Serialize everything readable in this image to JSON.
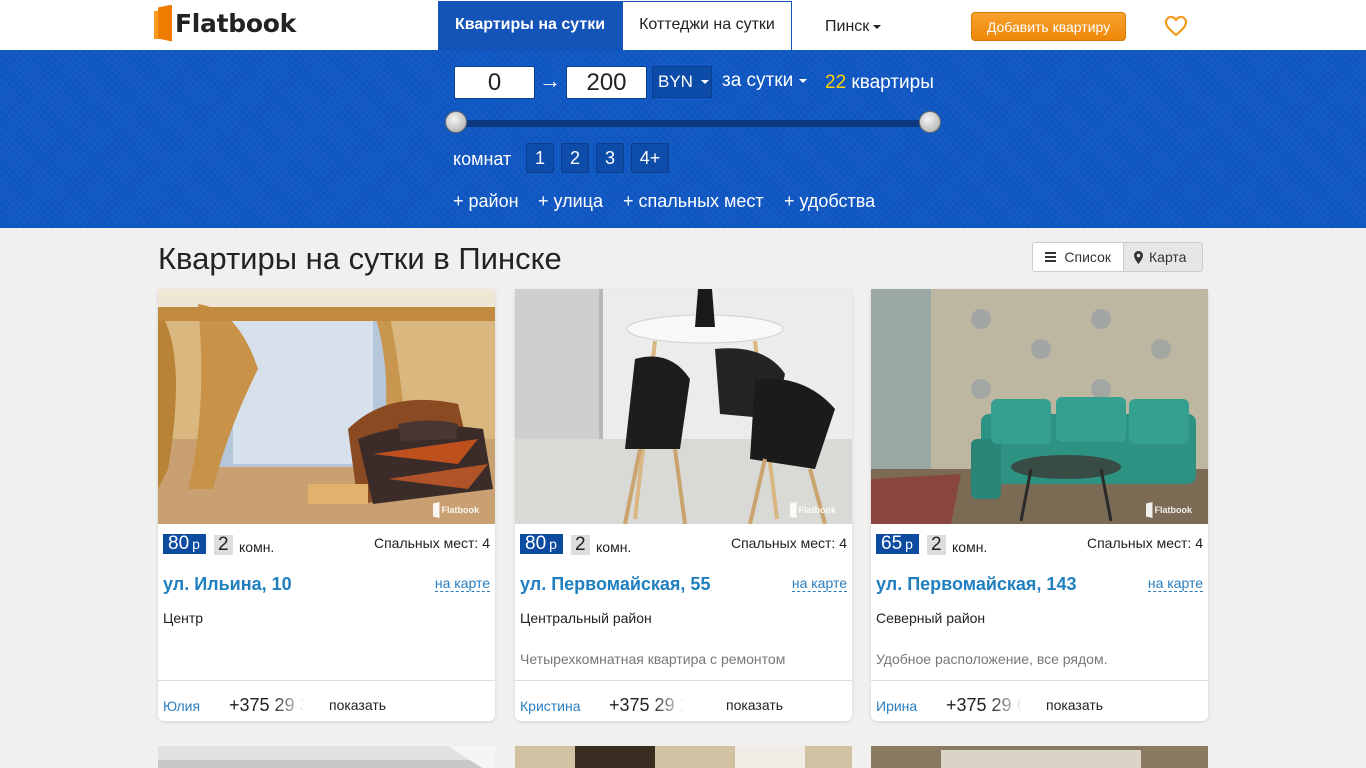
{
  "header": {
    "logo_text": "Flatbook",
    "tabs": [
      {
        "label": "Квартиры на сутки",
        "active": true
      },
      {
        "label": "Коттеджи на сутки",
        "active": false
      }
    ],
    "city": "Пинск",
    "add_button": "Добавить квартиру",
    "favorites_icon": "heart-icon"
  },
  "filter": {
    "price_min": "0",
    "price_max": "200",
    "currency": "BYN",
    "period": "за сутки",
    "result_count": "22",
    "result_label": "квартиры",
    "slider": {
      "min": 0,
      "max": 200,
      "low": 0,
      "high": 200
    },
    "rooms_label": "комнат",
    "rooms": [
      "1",
      "2",
      "3",
      "4+"
    ],
    "extra_filters": [
      "+ район",
      "+ улица",
      "+ спальных мест",
      "+ удобства"
    ]
  },
  "main": {
    "title": "Квартиры на сутки в Пинске",
    "view_list": "Список",
    "view_map": "Карта"
  },
  "watermark": "Flatbook",
  "listings": [
    {
      "price": "80",
      "currency_short": "р",
      "rooms": "2",
      "rooms_unit": "комн.",
      "beds": "Спальных мест: 4",
      "street": "ул. Ильина, 10",
      "map_link": "на карте",
      "district": "Центр",
      "description": "",
      "owner": "Юлия",
      "phone": "+375 29 3",
      "show": "показать"
    },
    {
      "price": "80",
      "currency_short": "р",
      "rooms": "2",
      "rooms_unit": "комн.",
      "beds": "Спальных мест: 4",
      "street": "ул. Первомайская, 55",
      "map_link": "на карте",
      "district": "Центральный район",
      "description": "Четырехкомнатная квартира с ремонтом",
      "owner": "Кристина",
      "phone": "+375 29 10",
      "show": "показать"
    },
    {
      "price": "65",
      "currency_short": "р",
      "rooms": "2",
      "rooms_unit": "комн.",
      "beds": "Спальных мест: 4",
      "street": "ул. Первомайская, 143",
      "map_link": "на карте",
      "district": "Северный район",
      "description": "Удобное расположение, все рядом.",
      "owner": "Ирина",
      "phone": "+375 29 6",
      "show": "показать"
    }
  ],
  "colors": {
    "brand_blue": "#1454b8",
    "accent_orange": "#f08a10",
    "link_blue": "#1f7fbf",
    "count_yellow": "#ffd400"
  }
}
